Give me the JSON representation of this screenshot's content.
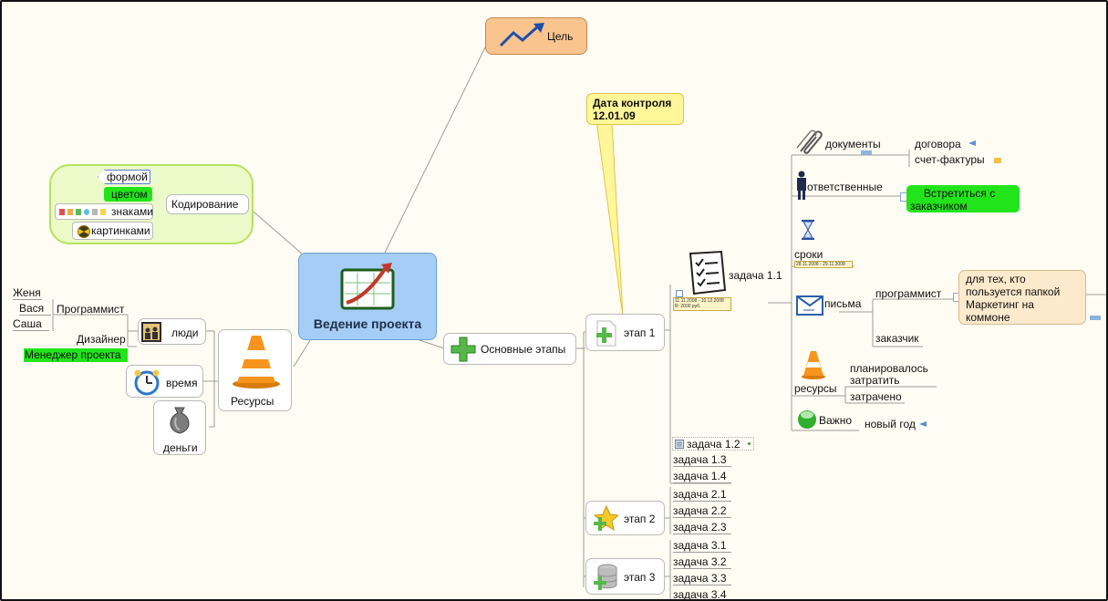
{
  "central": {
    "label": "Ведение проекта"
  },
  "goal": {
    "label": "Цель"
  },
  "callout": {
    "line1": "Дата контроля",
    "line2": "12.01.09"
  },
  "coding": {
    "label": "Кодирование",
    "items": [
      "формой",
      "цветом",
      "знаками",
      "картинками"
    ]
  },
  "resources": {
    "label": "Ресурсы",
    "people": "люди",
    "time": "время",
    "money": "деньги",
    "programmer": "Программист",
    "programmers": [
      "Женя",
      "Вася",
      "Саша"
    ],
    "designer": "Дизайнер",
    "manager": "Менеджер проекта"
  },
  "stages": {
    "label": "Основные этапы",
    "stage1": "этап 1",
    "stage2": "этап 2",
    "stage3": "этап 3",
    "task11": "задача 1.1",
    "task11_dates": "11.11.2008 - 10.12.2008",
    "task11_cost": "R: 2000 руб.",
    "stage1_tasks": [
      "задача 1.2",
      "задача 1.3",
      "задача 1.4"
    ],
    "stage2_tasks": [
      "задача 2.1",
      "задача 2.2",
      "задача 2.3"
    ],
    "stage3_tasks": [
      "задача 3.1",
      "задача 3.2",
      "задача 3.3",
      "задача 3.4"
    ]
  },
  "task_details": {
    "documents": "документы",
    "contracts": "договора",
    "invoices": "счет-фактуры",
    "responsible": "ответственные",
    "meet_line1": "Встретиться с",
    "meet_line2": "заказчиком",
    "deadlines": "сроки",
    "deadline_dates": "28.11.2008 - 29.11.2008",
    "letters": "письма",
    "programmer": "программист",
    "customer": "заказчик",
    "note_lines": [
      "для тех, кто",
      "пользуется папкой",
      "Маркетинг на",
      "коммоне"
    ],
    "resources": "ресурсы",
    "planned_line1": "планировалось",
    "planned_line2": "затратить",
    "spent": "затрачено",
    "important": "Важно",
    "new_year": "новый год"
  },
  "colors": {
    "goal_fill": "#f9c48e",
    "central_fill": "#a6cdf5",
    "highlight_green": "#22e41a",
    "callout_fill": "#fff79a",
    "coding_group": "#ecf9c9",
    "note_fill": "#fde9cc"
  }
}
